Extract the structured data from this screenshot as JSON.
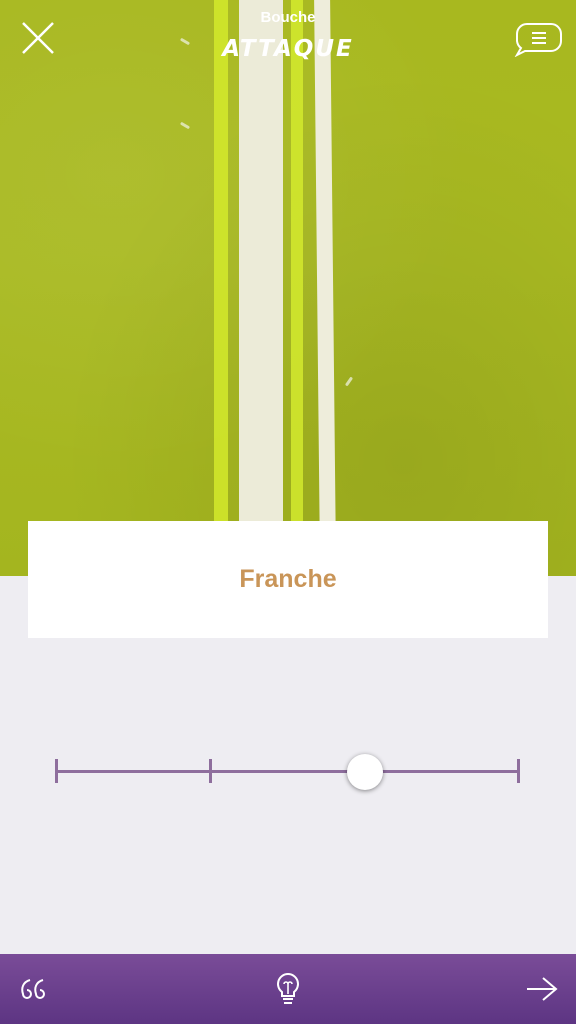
{
  "header": {
    "section": "Bouche",
    "title": "ATTAQUE"
  },
  "answer": {
    "label": "Franche"
  },
  "slider": {
    "stops": 4,
    "selected_index": 2
  },
  "icons": {
    "close": "close-icon",
    "menu": "chat-menu-icon",
    "quote": "quote-icon",
    "hint": "lightbulb-icon",
    "next": "arrow-right-icon"
  },
  "colors": {
    "hero_green": "#a8b81f",
    "answer_text": "#c99558",
    "slider": "#8e6e9d",
    "bottom_bar": "#6a4190"
  }
}
